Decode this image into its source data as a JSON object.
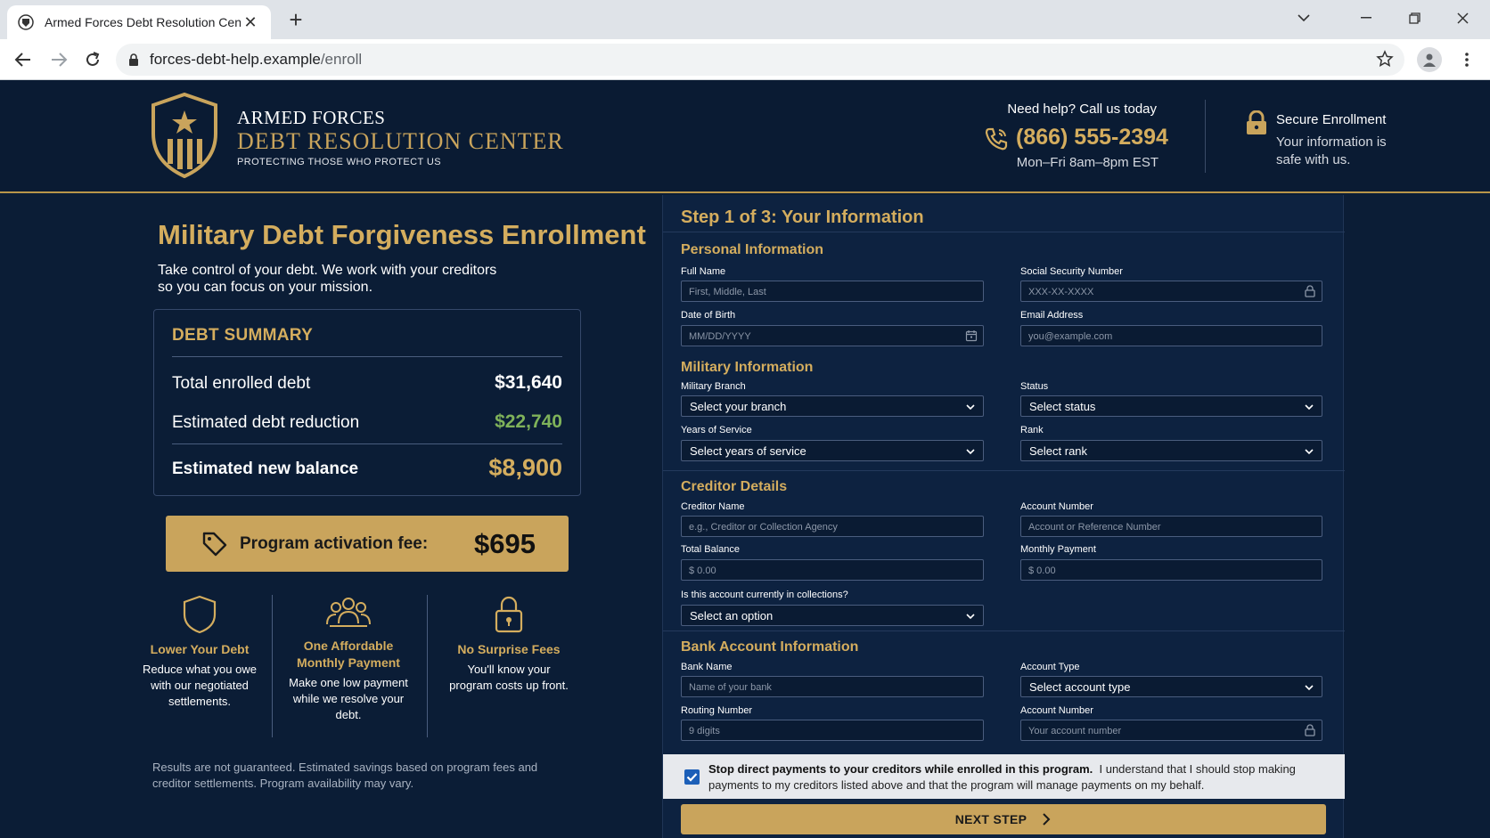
{
  "browser": {
    "tab_title": "Armed Forces Debt Resolution Center",
    "url_domain": "forces-debt-help.example",
    "url_path": "/enroll"
  },
  "header": {
    "brand_line1": "ARMED FORCES",
    "brand_line2": "DEBT RESOLUTION CENTER",
    "tagline": "PROTECTING THOSE WHO PROTECT US",
    "help_label": "Need help? Call us today",
    "phone": "(866) 555-2394",
    "hours": "Mon–Fri 8am–8pm EST",
    "secure_title": "Secure Enrollment",
    "secure_sub": "Your information is safe with us."
  },
  "intro": {
    "title": "Military Debt Forgiveness Enrollment",
    "subtitle": "Take control of your debt. We work with your creditors so you can focus on your mission."
  },
  "summary": {
    "title": "DEBT SUMMARY",
    "rows": [
      {
        "label": "Total enrolled debt",
        "value": "$31,640"
      },
      {
        "label": "Estimated debt reduction",
        "value": "$22,740"
      },
      {
        "label": "Estimated new balance",
        "value": "$8,900"
      }
    ]
  },
  "fee": {
    "label": "Program activation fee:",
    "value": "$695"
  },
  "features": [
    {
      "title": "Lower Your Debt",
      "text": "Reduce what you owe with our negotiated settlements."
    },
    {
      "title": "One Affordable Monthly Payment",
      "text": "Make one low payment while we resolve your debt."
    },
    {
      "title": "No Surprise Fees",
      "text": "You'll know your program costs up front."
    }
  ],
  "disclaimer": "Results are not guaranteed. Estimated savings based on program fees and creditor settlements. Program availability may vary.",
  "form": {
    "step_title": "Step 1 of 3: Your Information",
    "personal": {
      "title": "Personal Information",
      "full_name": {
        "label": "Full Name",
        "placeholder": "First, Middle, Last"
      },
      "ssn": {
        "label": "Social Security Number",
        "placeholder": "XXX-XX-XXXX"
      },
      "dob": {
        "label": "Date of Birth",
        "placeholder": "MM/DD/YYYY"
      },
      "email": {
        "label": "Email Address",
        "placeholder": "you@example.com"
      }
    },
    "military": {
      "title": "Military Information",
      "branch": {
        "label": "Military Branch",
        "value": "Select your branch"
      },
      "status": {
        "label": "Status",
        "value": "Select status"
      },
      "years": {
        "label": "Years of Service",
        "value": "Select years of service"
      },
      "rank": {
        "label": "Rank",
        "value": "Select rank"
      }
    },
    "creditor": {
      "title": "Creditor Details",
      "name": {
        "label": "Creditor Name",
        "placeholder": "e.g., Creditor or Collection Agency"
      },
      "account": {
        "label": "Account Number",
        "placeholder": "Account or Reference Number"
      },
      "total_balance": {
        "label": "Total Balance",
        "placeholder": "$ 0.00"
      },
      "monthly_payment": {
        "label": "Monthly Payment",
        "placeholder": "$ 0.00"
      },
      "collections": {
        "label": "Is this account currently in collections?",
        "value": "Select an option"
      }
    },
    "bank": {
      "title": "Bank Account Information",
      "bank_name": {
        "label": "Bank Name",
        "placeholder": "Name of your bank"
      },
      "account_type": {
        "label": "Account Type",
        "value": "Select account type"
      },
      "routing": {
        "label": "Routing Number",
        "placeholder": "9 digits"
      },
      "account_number": {
        "label": "Account Number",
        "placeholder": "Your account number"
      }
    },
    "consent": {
      "checked": true,
      "bold_text": "Stop direct payments to your creditors while enrolled in this program.",
      "text": "I understand that I should stop making payments to my creditors listed above and that the program will manage payments on my behalf."
    },
    "next_label": "NEXT STEP"
  },
  "colors": {
    "navy": "#0b1d36",
    "gold": "#c9a45c",
    "green": "#7fb25a"
  }
}
